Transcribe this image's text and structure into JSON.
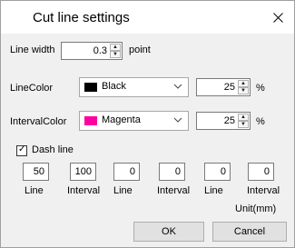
{
  "dialog": {
    "title": "Cut line settings",
    "close_symbol": "✕"
  },
  "line_width": {
    "label": "Line width",
    "value": "0.3",
    "unit": "point"
  },
  "line_color": {
    "label": "LineColor",
    "color_name": "Black",
    "color_hex": "#000000",
    "percent_value": "25",
    "percent_unit": "%"
  },
  "interval_color": {
    "label": "IntervalColor",
    "color_name": "Magenta",
    "color_hex": "#ff00a0",
    "percent_value": "25",
    "percent_unit": "%"
  },
  "dash_line": {
    "label": "Dash line",
    "checked": true,
    "check_mark": "✓",
    "values": [
      "50",
      "100",
      "0",
      "0",
      "0",
      "0"
    ],
    "labels": [
      "Line",
      "Interval",
      "Line",
      "Interval",
      "Line",
      "Interval"
    ],
    "unit_label": "Unit(mm)"
  },
  "buttons": {
    "ok": "OK",
    "cancel": "Cancel"
  }
}
